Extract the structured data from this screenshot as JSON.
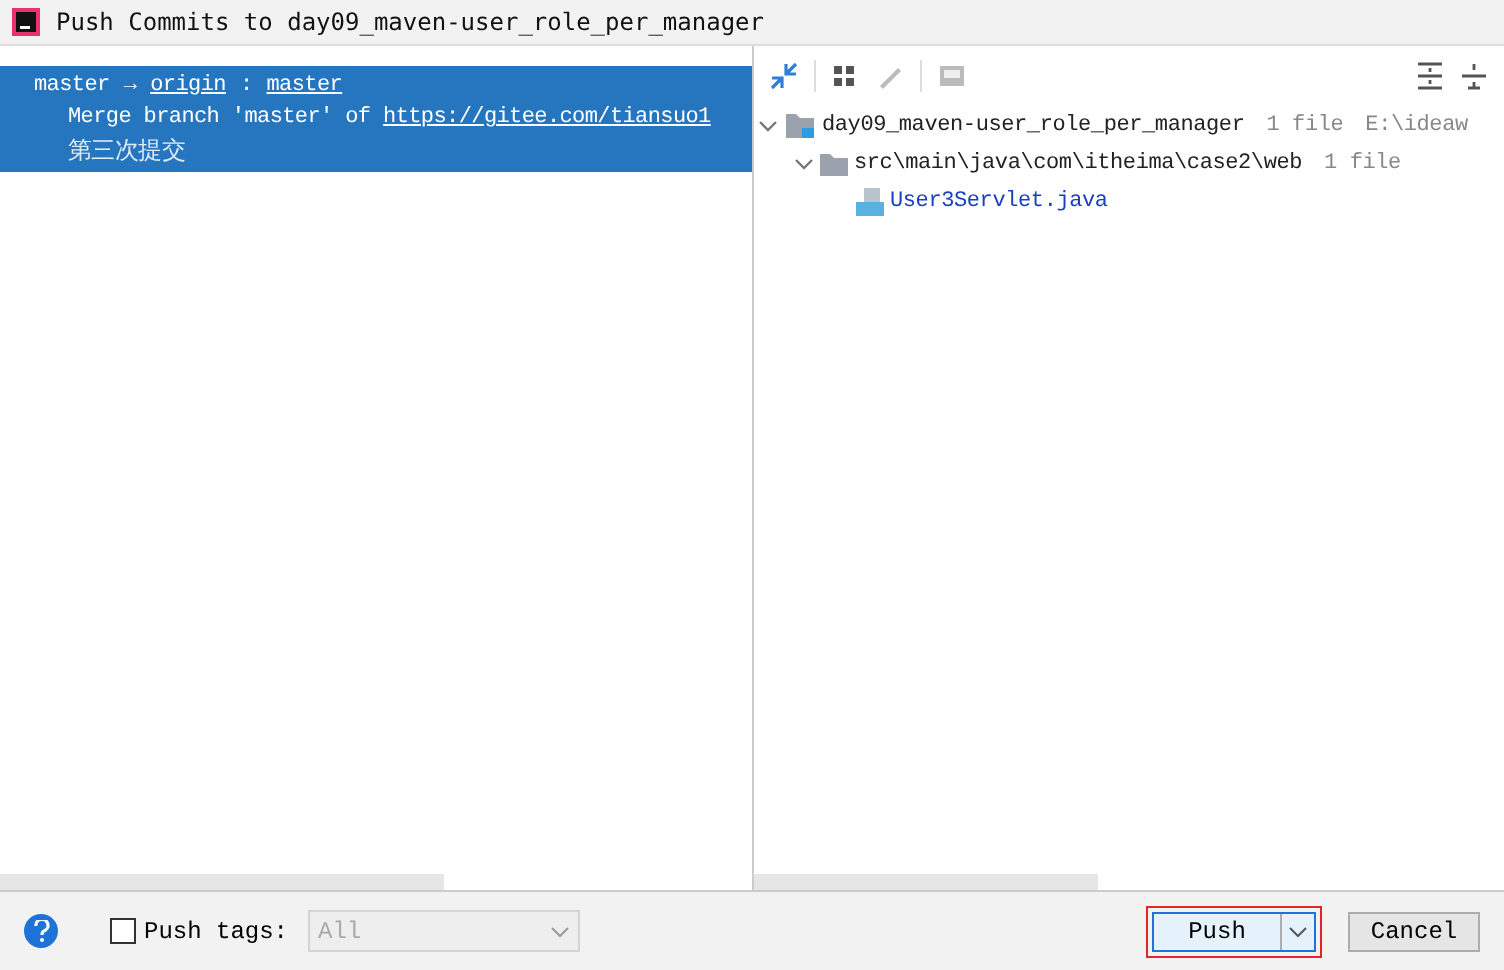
{
  "window": {
    "title": "Push Commits to day09_maven-user_role_per_manager"
  },
  "commits": {
    "local": "master",
    "arrow": "→",
    "remote": "origin",
    "separator": ":",
    "branch": "master",
    "selected": true,
    "entries": [
      {
        "message": "Merge branch 'master' of ",
        "link": "https://gitee.com/tiansuo1"
      },
      {
        "message": "第三次提交"
      }
    ]
  },
  "tree": [
    {
      "kind": "module",
      "name": "day09_maven-user_role_per_manager",
      "count": "1 file",
      "path": "E:\\ideaw",
      "expanded": true,
      "children": [
        {
          "kind": "folder",
          "name": "src\\main\\java\\com\\itheima\\case2\\web",
          "count": "1 file",
          "expanded": true,
          "children": [
            {
              "kind": "file",
              "name": "User3Servlet.java"
            }
          ]
        }
      ]
    }
  ],
  "footer": {
    "push_tags": {
      "label": "Push tags:",
      "checked": false
    },
    "tags_select": {
      "value": "All",
      "disabled": true
    },
    "buttons": [
      {
        "kind": "split",
        "label": "Push",
        "focused": true
      },
      {
        "kind": "plain",
        "label": "Cancel",
        "focused": false
      }
    ]
  }
}
